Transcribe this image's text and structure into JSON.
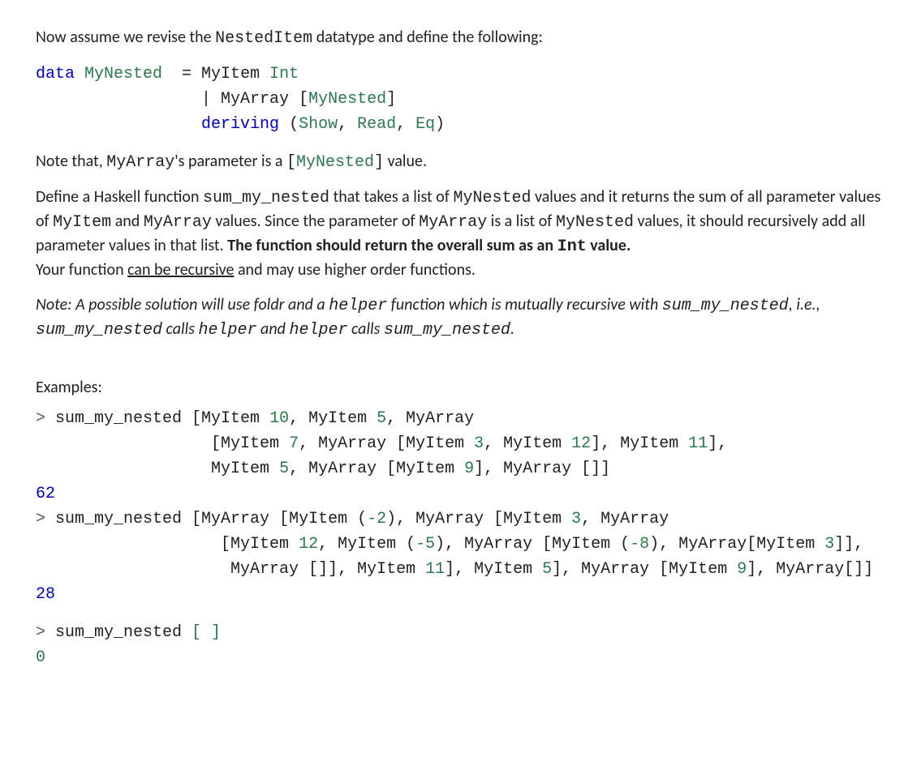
{
  "intro": {
    "t1": "Now assume we revise the ",
    "t2": "NestedItem",
    "t3": " datatype and define the following:"
  },
  "datadef": {
    "l1": {
      "kw": "data",
      "ty": "MyNested",
      "eq": "  = MyItem ",
      "int": "Int"
    },
    "l2": {
      "pipe": "| MyArray [",
      "ty": "MyNested",
      "close": "]"
    },
    "l3": {
      "kw": "deriving",
      "open": " (",
      "show": "Show",
      "c1": ", ",
      "read": "Read",
      "c2": ", ",
      "eq_": "Eq",
      "close": ")"
    }
  },
  "note1": {
    "t1": "Note that, ",
    "t2": "MyArray",
    "t3": "'s parameter is a ",
    "t4": "[",
    "t5": "MyNested",
    "t6": "]",
    "t7": " value."
  },
  "task": {
    "p1a": "Define a Haskell function ",
    "p1b": "sum_my_nested",
    "p1c": " that takes a list of ",
    "p1d": "MyNested",
    "p1e": "  values and it returns the sum of all parameter values of ",
    "p1f": "MyItem",
    "p1g": " and ",
    "p1h": "MyArray",
    "p1i": " values. Since the parameter of ",
    "p1j": "MyArray",
    "p1k": " is a list of ",
    "p1l": "MyNested",
    "p1m": " values, it should recursively add all parameter values in that list.  ",
    "bold1": "The function should return the overall sum as an ",
    "bold2": "Int",
    "bold3": " value.",
    "p2a": "Your function ",
    "p2b": "can be recursive",
    "p2c": " and may use higher order functions."
  },
  "note2": {
    "t1": "Note: A possible solution will use foldr and a ",
    "t2": "helper",
    "t3": " function which is mutually recursive with ",
    "t4": "sum_my_nested",
    "t5": ", i.e., ",
    "t6": "sum_my_nested",
    "t7": " calls ",
    "t8": "helper",
    "t9": " and ",
    "t10": "helper",
    "t11": " calls ",
    "t12": "sum_my_nested",
    "t13": "."
  },
  "examples_label": "Examples:",
  "ex1": {
    "p": ">",
    "fn": " sum_my_nested ",
    "a": "[MyItem ",
    "n1": "10",
    "b": ", MyItem ",
    "n2": "5",
    "c": ", MyArray",
    "line2a": "[MyItem ",
    "n3": "7",
    "line2b": ", MyArray [MyItem ",
    "n4": "3",
    "line2c": ", MyItem ",
    "n5": "12",
    "line2d": "], MyItem ",
    "n6": "11",
    "line2e": "],",
    "line3a": "MyItem ",
    "n7": "5",
    "line3b": ", MyArray [MyItem ",
    "n8": "9",
    "line3c": "], MyArray []]",
    "result": "62"
  },
  "ex2": {
    "p": ">",
    "fn": " sum_my_nested ",
    "a": "[MyArray [MyItem (",
    "n1": "-2",
    "b": "), MyArray [MyItem ",
    "n2": "3",
    "c": ", MyArray",
    "l2a": "[MyItem ",
    "n3": "12",
    "l2b": ", MyItem (",
    "n4": "-5",
    "l2c": "), MyArray [MyItem (",
    "n5": "-8",
    "l2d": "), MyArray[MyItem ",
    "n6": "3",
    "l2e": "]],",
    "l3a": "MyArray []], MyItem ",
    "n7": "11",
    "l3b": "], MyItem ",
    "n8": "5",
    "l3c": "], MyArray [MyItem ",
    "n9": "9",
    "l3d": "], MyArray[]]",
    "result": "28"
  },
  "ex3": {
    "p": ">",
    "fn": " sum_my_nested ",
    "arg": "[ ]",
    "result": "0"
  }
}
